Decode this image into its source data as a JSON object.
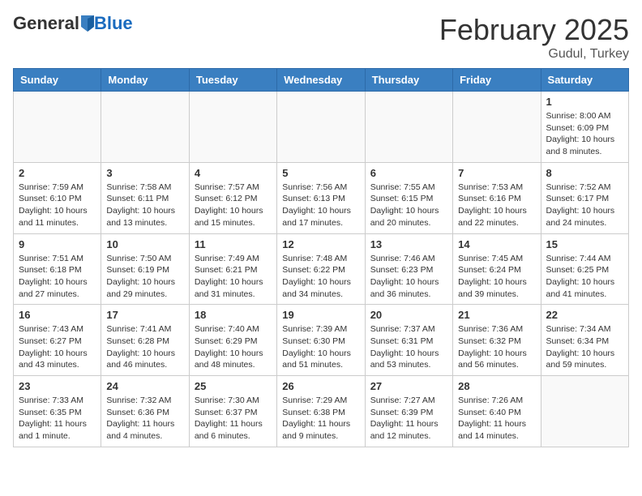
{
  "header": {
    "logo_general": "General",
    "logo_blue": "Blue",
    "title": "February 2025",
    "subtitle": "Gudul, Turkey"
  },
  "days_of_week": [
    "Sunday",
    "Monday",
    "Tuesday",
    "Wednesday",
    "Thursday",
    "Friday",
    "Saturday"
  ],
  "weeks": [
    [
      {
        "day": "",
        "info": ""
      },
      {
        "day": "",
        "info": ""
      },
      {
        "day": "",
        "info": ""
      },
      {
        "day": "",
        "info": ""
      },
      {
        "day": "",
        "info": ""
      },
      {
        "day": "",
        "info": ""
      },
      {
        "day": "1",
        "info": "Sunrise: 8:00 AM\nSunset: 6:09 PM\nDaylight: 10 hours and 8 minutes."
      }
    ],
    [
      {
        "day": "2",
        "info": "Sunrise: 7:59 AM\nSunset: 6:10 PM\nDaylight: 10 hours and 11 minutes."
      },
      {
        "day": "3",
        "info": "Sunrise: 7:58 AM\nSunset: 6:11 PM\nDaylight: 10 hours and 13 minutes."
      },
      {
        "day": "4",
        "info": "Sunrise: 7:57 AM\nSunset: 6:12 PM\nDaylight: 10 hours and 15 minutes."
      },
      {
        "day": "5",
        "info": "Sunrise: 7:56 AM\nSunset: 6:13 PM\nDaylight: 10 hours and 17 minutes."
      },
      {
        "day": "6",
        "info": "Sunrise: 7:55 AM\nSunset: 6:15 PM\nDaylight: 10 hours and 20 minutes."
      },
      {
        "day": "7",
        "info": "Sunrise: 7:53 AM\nSunset: 6:16 PM\nDaylight: 10 hours and 22 minutes."
      },
      {
        "day": "8",
        "info": "Sunrise: 7:52 AM\nSunset: 6:17 PM\nDaylight: 10 hours and 24 minutes."
      }
    ],
    [
      {
        "day": "9",
        "info": "Sunrise: 7:51 AM\nSunset: 6:18 PM\nDaylight: 10 hours and 27 minutes."
      },
      {
        "day": "10",
        "info": "Sunrise: 7:50 AM\nSunset: 6:19 PM\nDaylight: 10 hours and 29 minutes."
      },
      {
        "day": "11",
        "info": "Sunrise: 7:49 AM\nSunset: 6:21 PM\nDaylight: 10 hours and 31 minutes."
      },
      {
        "day": "12",
        "info": "Sunrise: 7:48 AM\nSunset: 6:22 PM\nDaylight: 10 hours and 34 minutes."
      },
      {
        "day": "13",
        "info": "Sunrise: 7:46 AM\nSunset: 6:23 PM\nDaylight: 10 hours and 36 minutes."
      },
      {
        "day": "14",
        "info": "Sunrise: 7:45 AM\nSunset: 6:24 PM\nDaylight: 10 hours and 39 minutes."
      },
      {
        "day": "15",
        "info": "Sunrise: 7:44 AM\nSunset: 6:25 PM\nDaylight: 10 hours and 41 minutes."
      }
    ],
    [
      {
        "day": "16",
        "info": "Sunrise: 7:43 AM\nSunset: 6:27 PM\nDaylight: 10 hours and 43 minutes."
      },
      {
        "day": "17",
        "info": "Sunrise: 7:41 AM\nSunset: 6:28 PM\nDaylight: 10 hours and 46 minutes."
      },
      {
        "day": "18",
        "info": "Sunrise: 7:40 AM\nSunset: 6:29 PM\nDaylight: 10 hours and 48 minutes."
      },
      {
        "day": "19",
        "info": "Sunrise: 7:39 AM\nSunset: 6:30 PM\nDaylight: 10 hours and 51 minutes."
      },
      {
        "day": "20",
        "info": "Sunrise: 7:37 AM\nSunset: 6:31 PM\nDaylight: 10 hours and 53 minutes."
      },
      {
        "day": "21",
        "info": "Sunrise: 7:36 AM\nSunset: 6:32 PM\nDaylight: 10 hours and 56 minutes."
      },
      {
        "day": "22",
        "info": "Sunrise: 7:34 AM\nSunset: 6:34 PM\nDaylight: 10 hours and 59 minutes."
      }
    ],
    [
      {
        "day": "23",
        "info": "Sunrise: 7:33 AM\nSunset: 6:35 PM\nDaylight: 11 hours and 1 minute."
      },
      {
        "day": "24",
        "info": "Sunrise: 7:32 AM\nSunset: 6:36 PM\nDaylight: 11 hours and 4 minutes."
      },
      {
        "day": "25",
        "info": "Sunrise: 7:30 AM\nSunset: 6:37 PM\nDaylight: 11 hours and 6 minutes."
      },
      {
        "day": "26",
        "info": "Sunrise: 7:29 AM\nSunset: 6:38 PM\nDaylight: 11 hours and 9 minutes."
      },
      {
        "day": "27",
        "info": "Sunrise: 7:27 AM\nSunset: 6:39 PM\nDaylight: 11 hours and 12 minutes."
      },
      {
        "day": "28",
        "info": "Sunrise: 7:26 AM\nSunset: 6:40 PM\nDaylight: 11 hours and 14 minutes."
      },
      {
        "day": "",
        "info": ""
      }
    ]
  ]
}
